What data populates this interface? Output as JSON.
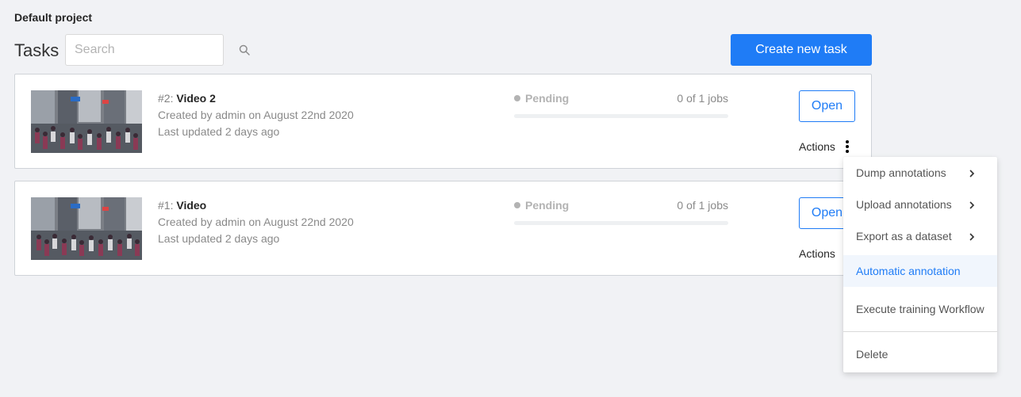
{
  "project": {
    "title": "Default project"
  },
  "header": {
    "title": "Tasks",
    "search_placeholder": "Search",
    "search_value": "",
    "create_label": "Create new task"
  },
  "tasks": [
    {
      "id_label": "#2: ",
      "name": "Video 2",
      "created": "Created by admin on August 22nd 2020",
      "updated": "Last updated 2 days ago",
      "status": "Pending",
      "jobs": "0 of 1 jobs",
      "progress": 0,
      "open_label": "Open",
      "actions_label": "Actions"
    },
    {
      "id_label": "#1: ",
      "name": "Video",
      "created": "Created by admin on August 22nd 2020",
      "updated": "Last updated 2 days ago",
      "status": "Pending",
      "jobs": "0 of 1 jobs",
      "progress": 0,
      "open_label": "Open",
      "actions_label": "Actions"
    }
  ],
  "actions_menu": {
    "items": [
      {
        "label": "Dump annotations",
        "has_submenu": true,
        "icon": "chevron-right-icon"
      },
      {
        "label": "Upload annotations",
        "has_submenu": true,
        "icon": "chevron-right-icon"
      },
      {
        "label": "Export as a dataset",
        "has_submenu": true,
        "icon": "chevron-right-icon"
      },
      {
        "label": "Automatic annotation",
        "has_submenu": false,
        "highlighted": true
      },
      {
        "label": "Execute training Workflow",
        "has_submenu": false
      },
      {
        "label": "Delete",
        "has_submenu": false
      }
    ]
  },
  "colors": {
    "accent": "#1f7cf6",
    "background": "#f1f2f5",
    "status_pending": "#b3b3b3"
  }
}
